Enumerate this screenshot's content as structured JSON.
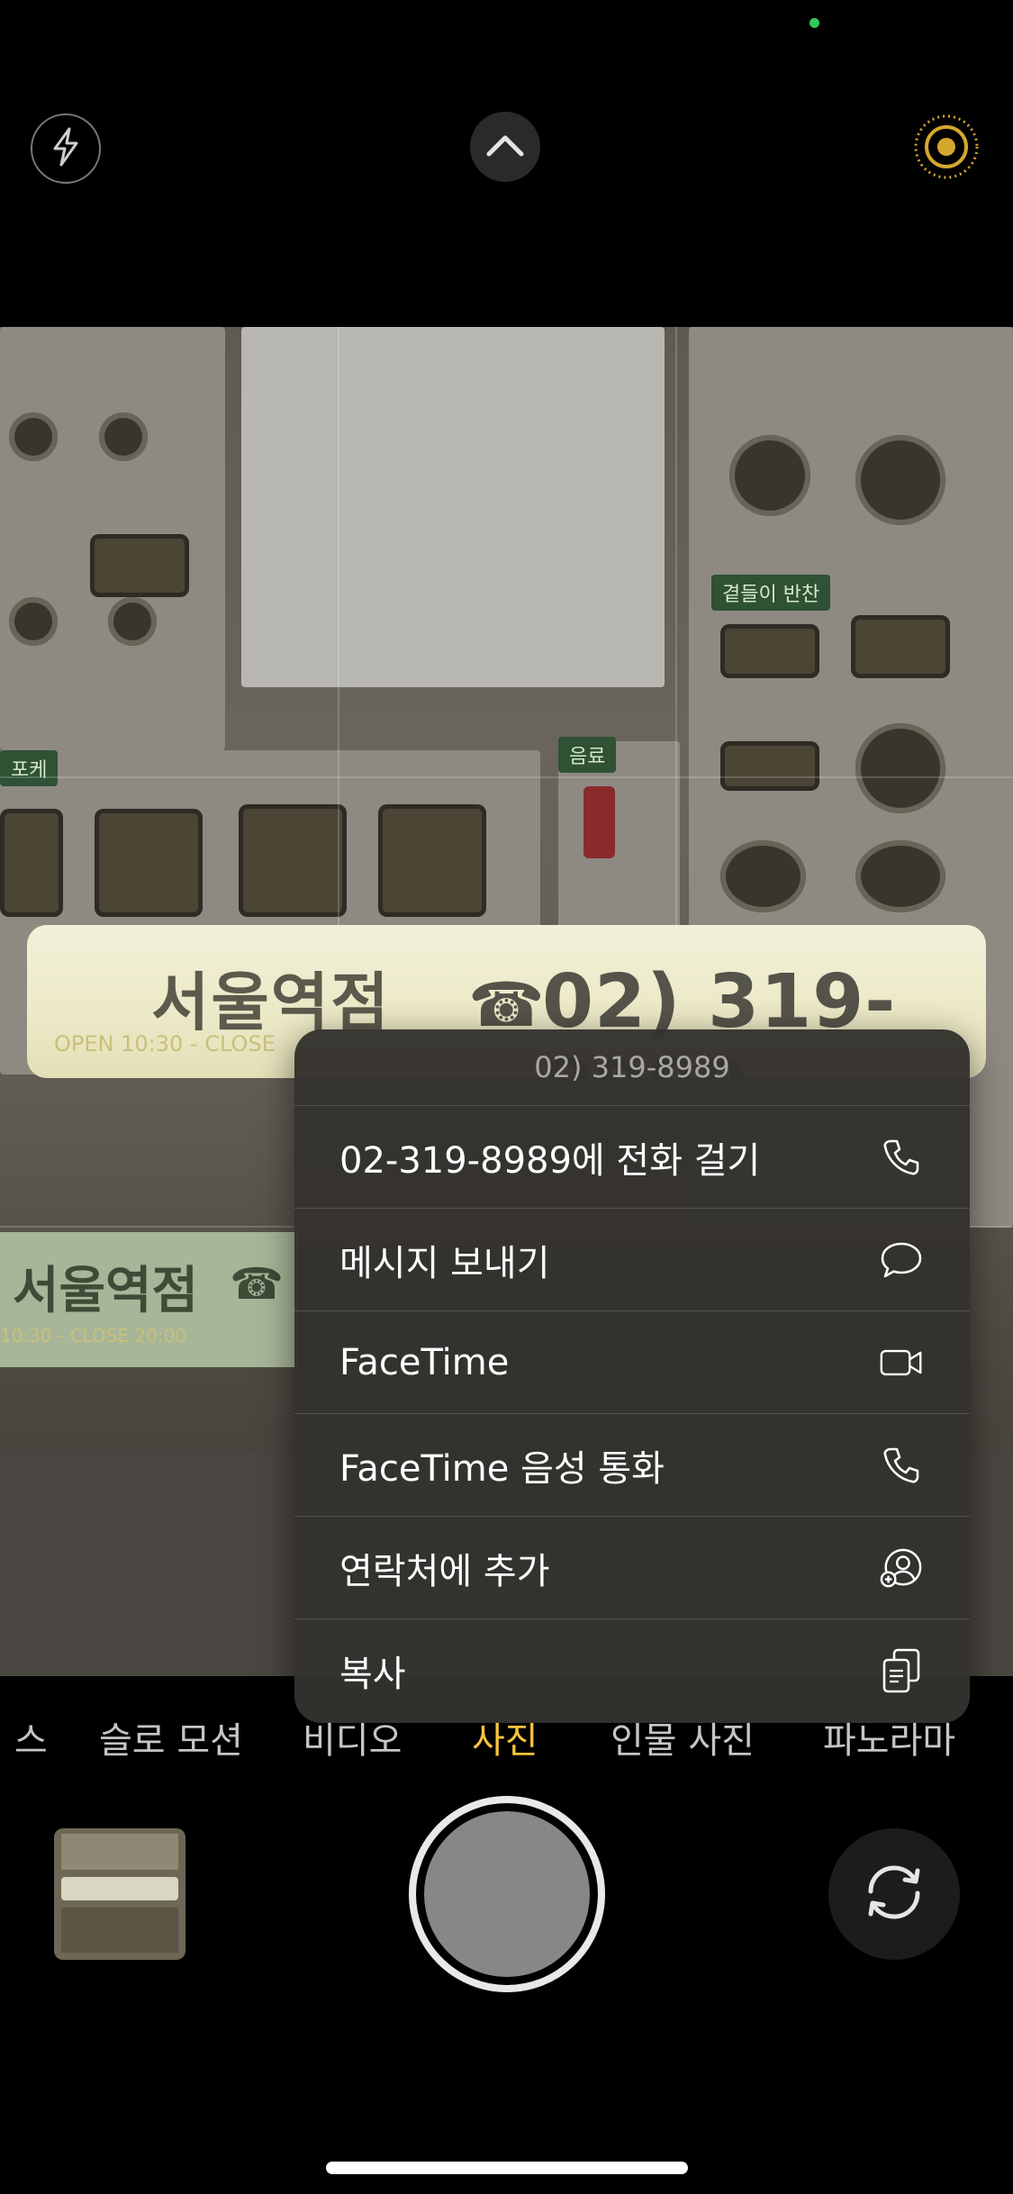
{
  "camera": {
    "top_bar": {
      "flash_icon": "flash-off-icon",
      "expand_icon": "chevron-up-icon",
      "live_icon": "live-photo-icon"
    },
    "scene": {
      "store_name": "서울역점",
      "phone_text": "02) 319-8989",
      "hours_text": "OPEN 10:30 - CLOSE",
      "lower_store_name": "서울역점",
      "lower_hours": "10:30 - CLOSE 20:00",
      "tag_side": "곁들이 반찬",
      "tag_drink": "음료",
      "tag_poke": "포케"
    },
    "context_menu": {
      "header": "02) 319-8989",
      "items": [
        {
          "label": "02-319-8989에 전화 걸기",
          "icon": "phone-icon"
        },
        {
          "label": "메시지 보내기",
          "icon": "message-bubble-icon"
        },
        {
          "label": "FaceTime",
          "icon": "video-camera-icon"
        },
        {
          "label": "FaceTime 음성 통화",
          "icon": "phone-icon"
        },
        {
          "label": "연락처에 추가",
          "icon": "add-contact-icon"
        },
        {
          "label": "복사",
          "icon": "copy-icon"
        }
      ]
    },
    "modes": [
      {
        "label": "스",
        "active": false
      },
      {
        "label": "슬로 모션",
        "active": false
      },
      {
        "label": "비디오",
        "active": false
      },
      {
        "label": "사진",
        "active": true
      },
      {
        "label": "인물 사진",
        "active": false
      },
      {
        "label": "파노라마",
        "active": false
      }
    ],
    "colors": {
      "accent": "#f7c33a",
      "menu_bg": "#34322e",
      "indicator": "#34c759"
    }
  }
}
